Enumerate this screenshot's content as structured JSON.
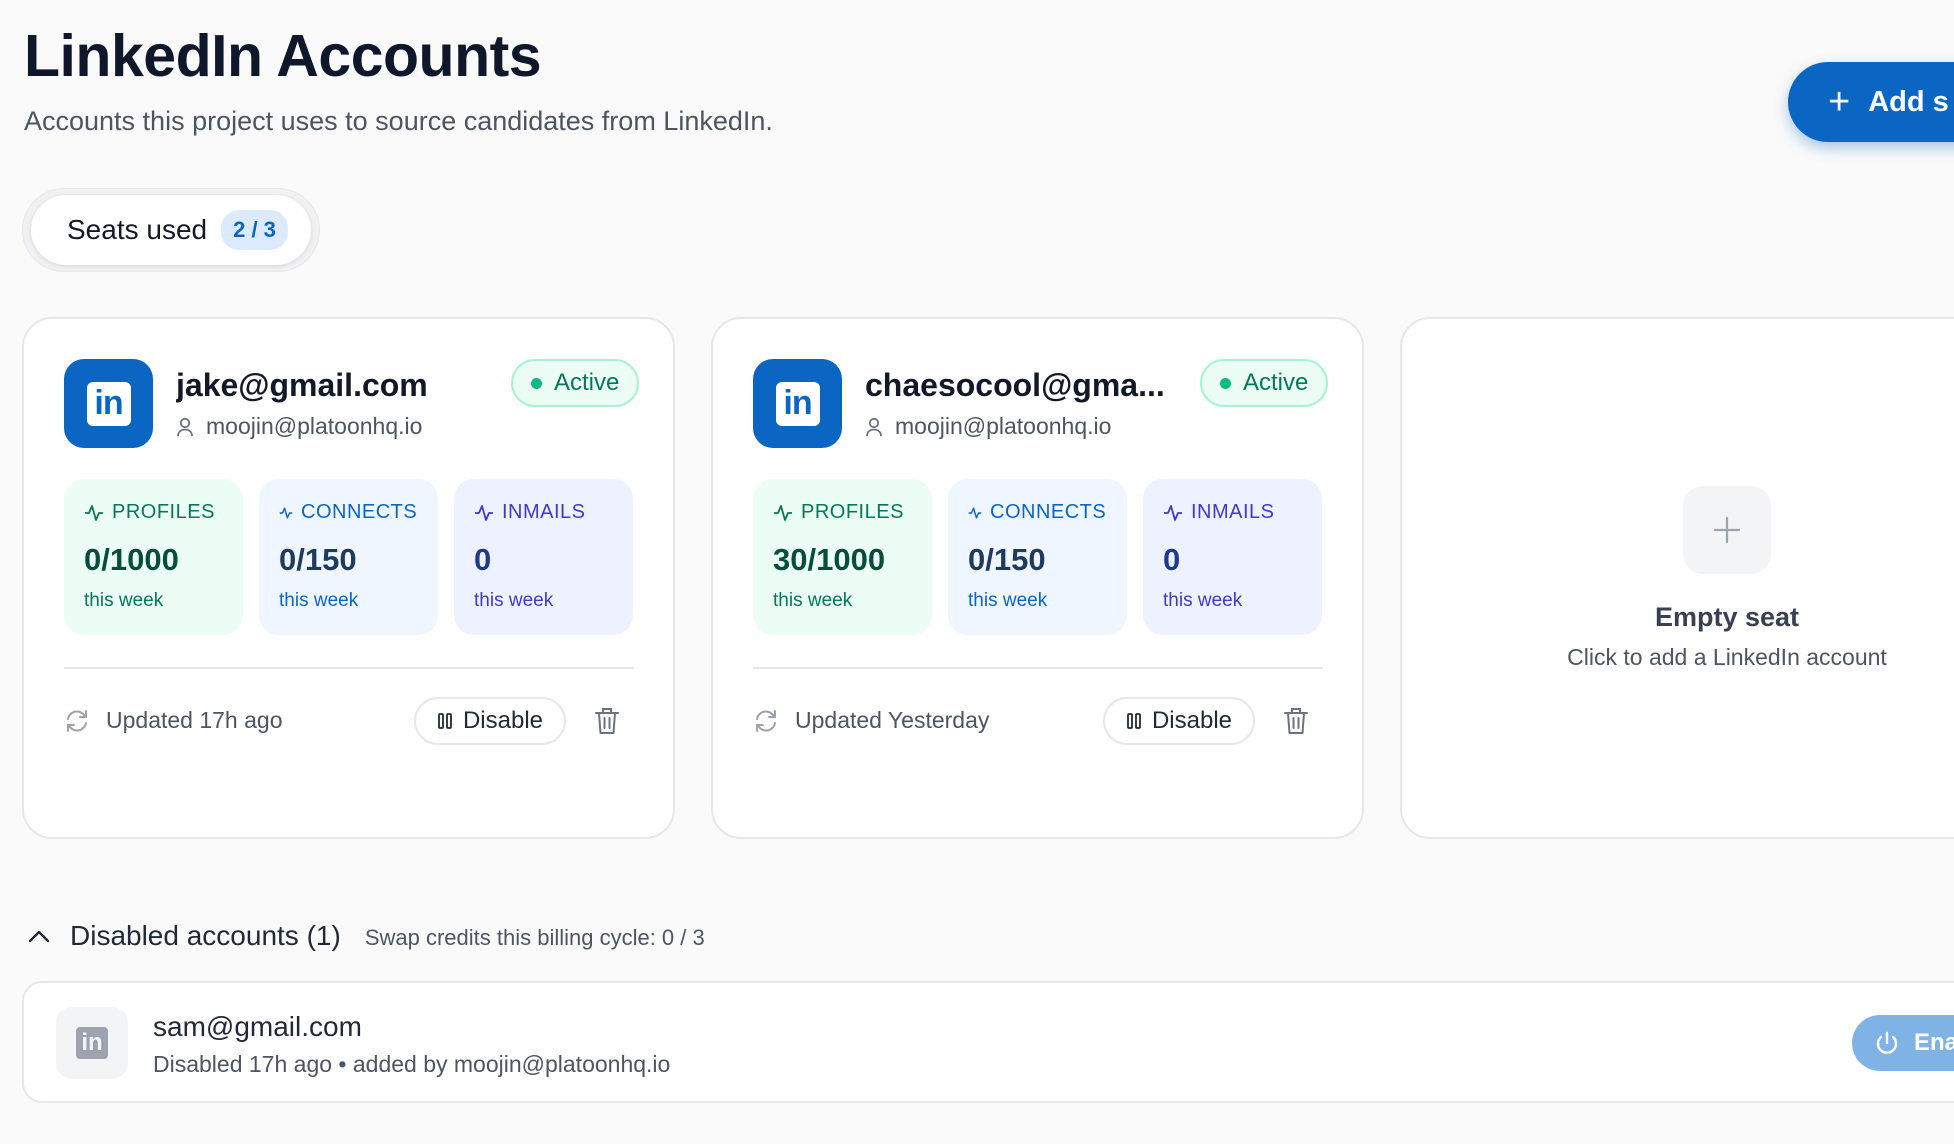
{
  "header": {
    "title": "LinkedIn Accounts",
    "subtitle": "Accounts this project uses to source candidates from LinkedIn.",
    "add_button_label": "Add s"
  },
  "seats": {
    "label": "Seats used",
    "value": "2 / 3"
  },
  "accounts": [
    {
      "email": "jake@gmail.com",
      "owner": "moojin@platoonhq.io",
      "status": "Active",
      "metrics": {
        "profiles": {
          "label": "PROFILES",
          "value": "0/1000",
          "period": "this week"
        },
        "connects": {
          "label": "CONNECTS",
          "value": "0/150",
          "period": "this week"
        },
        "inmails": {
          "label": "INMAILS",
          "value": "0",
          "period": "this week"
        }
      },
      "updated": "Updated 17h ago",
      "disable_label": "Disable"
    },
    {
      "email": "chaesocool@gma...",
      "owner": "moojin@platoonhq.io",
      "status": "Active",
      "metrics": {
        "profiles": {
          "label": "PROFILES",
          "value": "30/1000",
          "period": "this week"
        },
        "connects": {
          "label": "CONNECTS",
          "value": "0/150",
          "period": "this week"
        },
        "inmails": {
          "label": "INMAILS",
          "value": "0",
          "period": "this week"
        }
      },
      "updated": "Updated Yesterday",
      "disable_label": "Disable"
    }
  ],
  "empty_seat": {
    "title": "Empty seat",
    "subtitle": "Click to add a LinkedIn account"
  },
  "disabled_section": {
    "title": "Disabled accounts (1)",
    "swap_credits": "Swap credits this billing cycle: 0 / 3",
    "items": [
      {
        "email": "sam@gmail.com",
        "meta": "Disabled 17h ago • added by moojin@platoonhq.io",
        "enable_label": "Ena"
      }
    ]
  },
  "icons": {
    "linkedin_mark": "in"
  },
  "colors": {
    "brand": "#0a66c2",
    "active_green": "#10b981"
  }
}
